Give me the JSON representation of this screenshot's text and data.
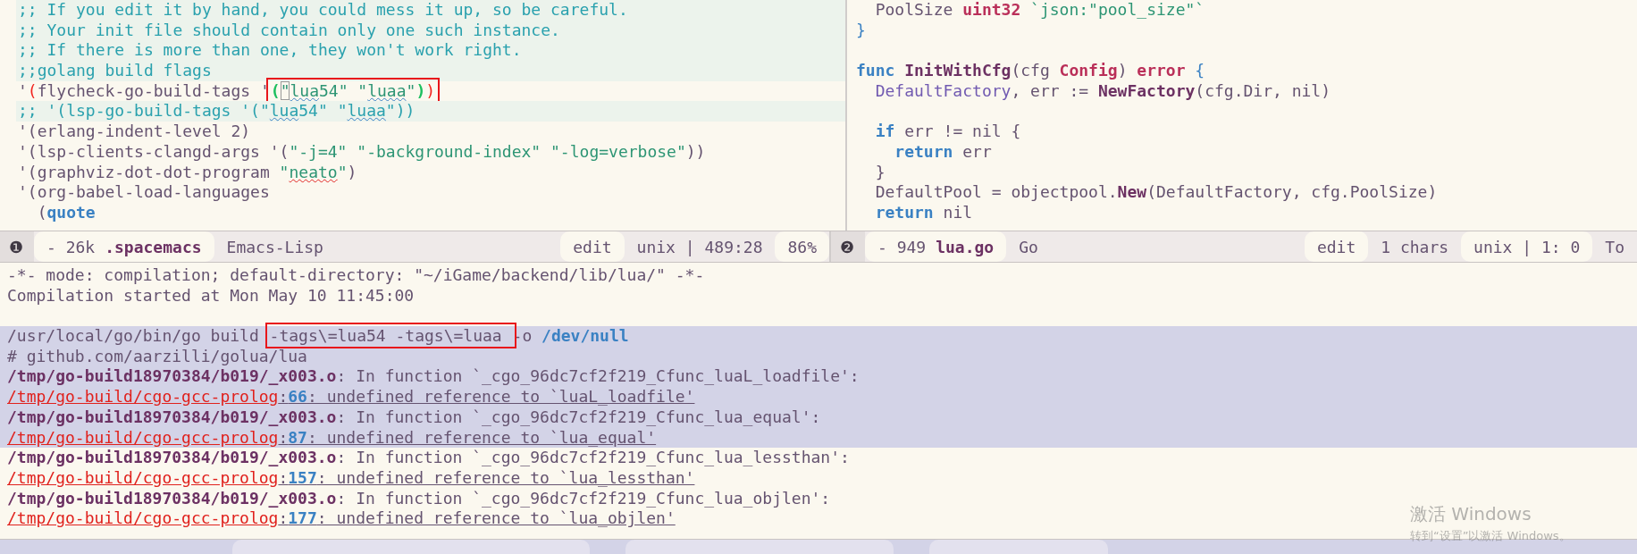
{
  "top_left_pane": {
    "lines": [
      {
        "highlighted": true,
        "segments": [
          {
            "text": ";; If you edit it by hand, you could mess it up, so be careful.",
            "kind": "comment"
          }
        ]
      },
      {
        "highlighted": true,
        "segments": [
          {
            "text": ";; Your init file should contain only one such instance.",
            "kind": "comment"
          }
        ]
      },
      {
        "highlighted": true,
        "segments": [
          {
            "text": ";; If there is more than one, they won't work right.",
            "kind": "comment"
          }
        ]
      },
      {
        "highlighted": true,
        "segments": [
          {
            "text": ";;golang build flags",
            "kind": "comment"
          }
        ]
      },
      {
        "highlighted": false,
        "segments": [
          {
            "text": "'",
            "kind": "base"
          },
          {
            "text": "(",
            "kind": "delim-outer"
          },
          {
            "text": "flycheck-go-build-tags '",
            "kind": "base"
          },
          {
            "kind": "annotated",
            "segments": [
              {
                "text": "(",
                "kind": "delim-inner"
              },
              {
                "text": "\"",
                "kind": "cursor"
              },
              {
                "text": "lua",
                "kind": "string-spell"
              },
              {
                "text": "54\" \"",
                "kind": "string"
              },
              {
                "text": "luaa",
                "kind": "string-spell"
              },
              {
                "text": "\"",
                "kind": "string"
              },
              {
                "text": ")",
                "kind": "delim-inner"
              },
              {
                "text": ")",
                "kind": "delim-outer"
              }
            ]
          }
        ]
      },
      {
        "highlighted": true,
        "segments": [
          {
            "text": ";; '(lsp-go-build-tags '(\"",
            "kind": "comment"
          },
          {
            "text": "lua",
            "kind": "comment-spell"
          },
          {
            "text": "54\" \"",
            "kind": "comment"
          },
          {
            "text": "luaa",
            "kind": "comment-spell"
          },
          {
            "text": "\"))",
            "kind": "comment"
          }
        ]
      },
      {
        "highlighted": false,
        "segments": [
          {
            "text": "'(erlang-indent-level 2)",
            "kind": "base"
          }
        ]
      },
      {
        "highlighted": false,
        "segments": [
          {
            "text": "'(lsp-clients-clangd-args '(",
            "kind": "base"
          },
          {
            "text": "\"-j=4\" \"-background-index\" \"-log=verbose\"",
            "kind": "string"
          },
          {
            "text": "))",
            "kind": "base"
          }
        ]
      },
      {
        "highlighted": false,
        "segments": [
          {
            "text": "'(graphviz-dot-dot-program ",
            "kind": "base"
          },
          {
            "text": "\"",
            "kind": "string"
          },
          {
            "text": "neato",
            "kind": "string-typo"
          },
          {
            "text": "\"",
            "kind": "string"
          },
          {
            "text": ")",
            "kind": "base"
          }
        ]
      },
      {
        "highlighted": false,
        "segments": [
          {
            "text": "'(org-babel-load-languages",
            "kind": "base"
          }
        ]
      },
      {
        "highlighted": false,
        "segments": [
          {
            "text": "  (",
            "kind": "base"
          },
          {
            "text": "quote",
            "kind": "keyword"
          }
        ]
      }
    ],
    "mode_line": {
      "left": [
        {
          "kind": "badge",
          "text": "❶"
        },
        {
          "kind": "buffer",
          "size": "- 26k",
          "buffer": ".spacemacs"
        },
        {
          "kind": "flat",
          "text": "Emacs-Lisp"
        }
      ],
      "right": [
        {
          "kind": "tab",
          "text": "edit"
        },
        {
          "kind": "flat",
          "text": "unix | 489:28"
        },
        {
          "kind": "tab",
          "text": "86%"
        }
      ]
    }
  },
  "top_right_pane": {
    "lines": [
      {
        "highlighted": false,
        "segments": [
          {
            "text": "  PoolSize ",
            "kind": "base"
          },
          {
            "text": "uint32",
            "kind": "type"
          },
          {
            "text": " `json:\"pool_size\"`",
            "kind": "string"
          }
        ]
      },
      {
        "highlighted": false,
        "segments": [
          {
            "text": "}",
            "kind": "brace"
          }
        ]
      },
      {
        "highlighted": false
      },
      {
        "highlighted": false,
        "segments": [
          {
            "text": "func ",
            "kind": "keyword"
          },
          {
            "text": "InitWithCfg",
            "kind": "function"
          },
          {
            "text": "(cfg ",
            "kind": "base"
          },
          {
            "text": "Config",
            "kind": "type"
          },
          {
            "text": ") ",
            "kind": "base"
          },
          {
            "text": "error",
            "kind": "type"
          },
          {
            "text": " {",
            "kind": "brace"
          }
        ]
      },
      {
        "highlighted": false,
        "segments": [
          {
            "text": "  DefaultFactory",
            "kind": "variable"
          },
          {
            "text": ", err := ",
            "kind": "base"
          },
          {
            "text": "NewFactory",
            "kind": "function"
          },
          {
            "text": "(cfg.Dir, nil)",
            "kind": "base"
          }
        ]
      },
      {
        "highlighted": false
      },
      {
        "highlighted": false,
        "segments": [
          {
            "text": "  if",
            "kind": "keyword"
          },
          {
            "text": " err != nil {",
            "kind": "base"
          }
        ]
      },
      {
        "highlighted": false,
        "segments": [
          {
            "text": "    return",
            "kind": "keyword"
          },
          {
            "text": " err",
            "kind": "base"
          }
        ]
      },
      {
        "highlighted": false,
        "segments": [
          {
            "text": "  }",
            "kind": "base"
          }
        ]
      },
      {
        "highlighted": false,
        "segments": [
          {
            "text": "  DefaultPool = objectpool.",
            "kind": "base"
          },
          {
            "text": "New",
            "kind": "function"
          },
          {
            "text": "(DefaultFactory, cfg.PoolSize)",
            "kind": "base"
          }
        ]
      },
      {
        "highlighted": false,
        "segments": [
          {
            "text": "  return",
            "kind": "keyword"
          },
          {
            "text": " nil",
            "kind": "base"
          }
        ]
      }
    ],
    "mode_line": {
      "left": [
        {
          "kind": "badge",
          "text": "❷"
        },
        {
          "kind": "buffer",
          "size": "- 949",
          "buffer": "lua.go"
        },
        {
          "kind": "flat",
          "text": "Go"
        }
      ],
      "right": [
        {
          "kind": "tab",
          "text": "edit"
        },
        {
          "kind": "flat",
          "text": "1 chars"
        },
        {
          "kind": "tab",
          "text": "unix | 1: 0"
        },
        {
          "kind": "flat",
          "text": "To"
        }
      ]
    }
  },
  "compilation_pane": {
    "lines": [
      {
        "highlighted": false,
        "segments": [
          {
            "text": "-*- mode: compilation; default-directory: \"~/iGame/backend/lib/lua/\" -*-",
            "kind": "base"
          }
        ]
      },
      {
        "highlighted": false,
        "segments": [
          {
            "text": "Compilation started at Mon May 10 11:45:00",
            "kind": "base"
          }
        ]
      },
      {
        "highlighted": false
      },
      {
        "highlighted": true,
        "segments": [
          {
            "text": "/usr/local/go/bin/go build ",
            "kind": "base"
          },
          {
            "kind": "annotated",
            "segments": [
              {
                "text": "-tags\\=lua54 -tags\\=luaa ",
                "kind": "base"
              }
            ]
          },
          {
            "text": "-o ",
            "kind": "base"
          },
          {
            "text": "/dev/null",
            "kind": "keyword"
          }
        ]
      },
      {
        "highlighted": true,
        "segments": [
          {
            "text": "# github.com/aarzilli/golua/lua",
            "kind": "base"
          }
        ]
      },
      {
        "highlighted": true,
        "segments": [
          {
            "text": "/tmp/go-build18970384/b019/_x003.o",
            "kind": "file"
          },
          {
            "text": ": In function `_cgo_96dc7cf2f219_Cfunc_luaL_loadfile':",
            "kind": "base"
          }
        ]
      },
      {
        "highlighted": true,
        "segments": [
          {
            "text": "/tmp/go-build/cgo-gcc-prolog",
            "kind": "error-file"
          },
          {
            "text": ":",
            "kind": "underlined"
          },
          {
            "text": "66",
            "kind": "line-number"
          },
          {
            "text": ": undefined reference to `luaL_loadfile'",
            "kind": "underlined"
          }
        ]
      },
      {
        "highlighted": true,
        "segments": [
          {
            "text": "/tmp/go-build18970384/b019/_x003.o",
            "kind": "file"
          },
          {
            "text": ": In function `_cgo_96dc7cf2f219_Cfunc_lua_equal':",
            "kind": "base"
          }
        ]
      },
      {
        "highlighted": true,
        "segments": [
          {
            "text": "/tmp/go-build/cgo-gcc-prolog",
            "kind": "error-file"
          },
          {
            "text": ":",
            "kind": "underlined"
          },
          {
            "text": "87",
            "kind": "line-number"
          },
          {
            "text": ": undefined reference to `lua_equal'",
            "kind": "underlined"
          }
        ]
      },
      {
        "highlighted": false,
        "segments": [
          {
            "text": "/tmp/go-build18970384/b019/_x003.o",
            "kind": "file"
          },
          {
            "text": ": In function `_cgo_96dc7cf2f219_Cfunc_lua_lessthan':",
            "kind": "base"
          }
        ]
      },
      {
        "highlighted": false,
        "segments": [
          {
            "text": "/tmp/go-build/cgo-gcc-prolog",
            "kind": "error-file"
          },
          {
            "text": ":",
            "kind": "underlined"
          },
          {
            "text": "157",
            "kind": "line-number"
          },
          {
            "text": ": undefined reference to `lua_lessthan'",
            "kind": "underlined"
          }
        ]
      },
      {
        "highlighted": false,
        "segments": [
          {
            "text": "/tmp/go-build18970384/b019/_x003.o",
            "kind": "file"
          },
          {
            "text": ": In function `_cgo_96dc7cf2f219_Cfunc_lua_objlen':",
            "kind": "base"
          }
        ]
      },
      {
        "highlighted": false,
        "segments": [
          {
            "text": "/tmp/go-build/cgo-gcc-prolog",
            "kind": "error-file"
          },
          {
            "text": ":",
            "kind": "underlined"
          },
          {
            "text": "177",
            "kind": "line-number"
          },
          {
            "text": ": undefined reference to `lua_objlen'",
            "kind": "underlined"
          }
        ]
      }
    ]
  },
  "os_notice": {
    "title": "激活 Windows",
    "hint": "转到“设置”以激活 Windows。"
  }
}
